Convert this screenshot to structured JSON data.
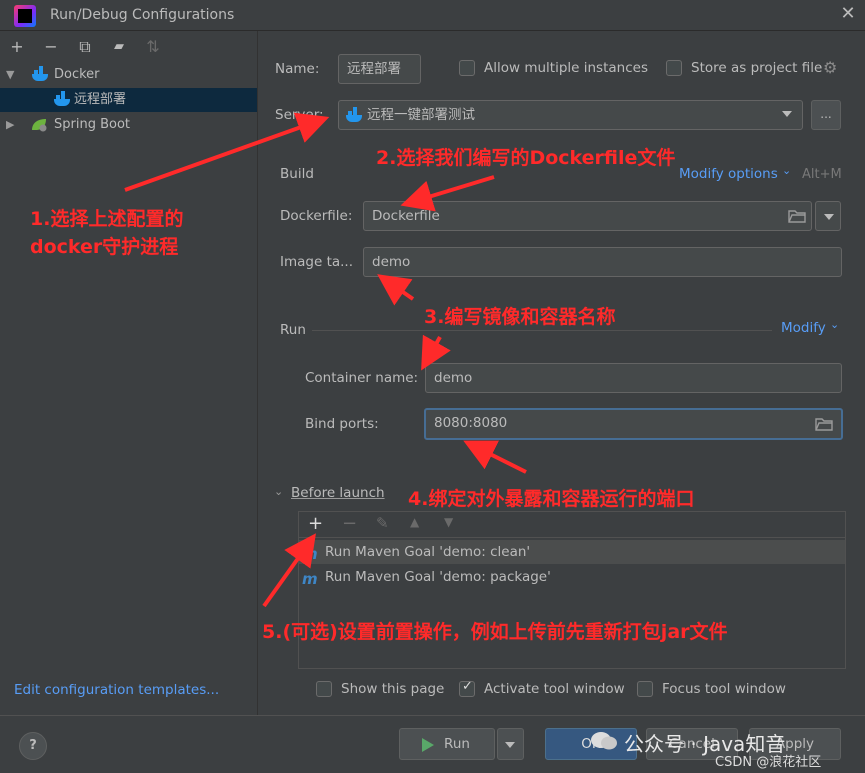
{
  "window": {
    "title": "Run/Debug Configurations"
  },
  "sidebar": {
    "toolbar": [
      {
        "name": "add-icon",
        "glyph": "+"
      },
      {
        "name": "remove-icon",
        "glyph": "−"
      },
      {
        "name": "copy-icon",
        "glyph": "⧉"
      },
      {
        "name": "new-folder-icon",
        "glyph": "▰"
      },
      {
        "name": "sort-icon",
        "glyph": "⇅"
      }
    ],
    "tree": {
      "docker_label": "Docker",
      "docker_child_label": "远程部署",
      "spring_label": "Spring Boot"
    },
    "edit_templates_label": "Edit configuration templates..."
  },
  "form": {
    "name_label": "Name:",
    "name_value": "远程部署",
    "allow_multiple_label": "Allow multiple instances",
    "store_project_label": "Store as project file",
    "server_label": "Server:",
    "server_value": "远程一键部署测试",
    "server_more": "...",
    "build_title": "Build",
    "modify_options_label": "Modify options",
    "modify_shortcut": "Alt+M",
    "dockerfile_label": "Dockerfile:",
    "dockerfile_value": "Dockerfile",
    "image_tag_label": "Image ta...",
    "image_tag_value": "demo",
    "run_title": "Run",
    "modify_label": "Modify",
    "container_name_label": "Container name:",
    "container_name_value": "demo",
    "bind_ports_label": "Bind ports:",
    "bind_ports_value": "8080:8080",
    "before_launch_label": "Before launch",
    "before_launch_items": [
      "Run Maven Goal 'demo: clean'",
      "Run Maven Goal 'demo: package'"
    ],
    "show_this_page_label": "Show this page",
    "activate_tool_window_label": "Activate tool window",
    "focus_tool_window_label": "Focus tool window"
  },
  "footer": {
    "help_label": "?",
    "run_label": "Run",
    "ok_label": "OK",
    "cancel_label": "Cancel",
    "apply_label": "Apply"
  },
  "annotations": {
    "a1_line1": "1.选择上述配置的",
    "a1_line2": "docker守护进程",
    "a2": "2.选择我们编写的Dockerfile文件",
    "a3": "3.编写镜像和容器名称",
    "a4": "4.绑定对外暴露和容器运行的端口",
    "a5": "5.(可选)设置前置操作，例如上传前先重新打包jar文件"
  },
  "watermark": {
    "main": "公众号 · Java知音",
    "sub": "CSDN @浪花社区"
  },
  "colors": {
    "background": "#3c3f41",
    "field": "#45494a",
    "link": "#589df6",
    "annotation": "#ff2a2a",
    "primary_button": "#365880"
  }
}
